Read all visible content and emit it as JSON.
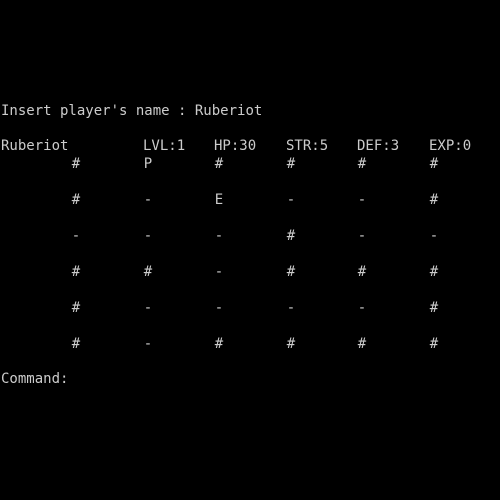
{
  "console": {
    "name_prompt": "Insert player's name : ",
    "name_value": "Ruberiot",
    "command_prompt": "Command:"
  },
  "stats": {
    "player_name": "Ruberiot",
    "level": "LVL:1",
    "hp": "HP:30",
    "strength": "STR:5",
    "defense": "DEF:3",
    "experience": "EXP:0"
  },
  "map": {
    "rows": [
      [
        "#",
        "P",
        "#",
        "#",
        "#",
        "#"
      ],
      [
        "#",
        "-",
        "E",
        "-",
        "-",
        "#"
      ],
      [
        "-",
        "-",
        "-",
        "#",
        "-",
        "-"
      ],
      [
        "#",
        "#",
        "-",
        "#",
        "#",
        "#"
      ],
      [
        "#",
        "-",
        "-",
        "-",
        "-",
        "#"
      ],
      [
        "#",
        "-",
        "#",
        "#",
        "#",
        "#"
      ]
    ]
  },
  "colors": {
    "background": "#000000",
    "text": "#cccccc"
  }
}
